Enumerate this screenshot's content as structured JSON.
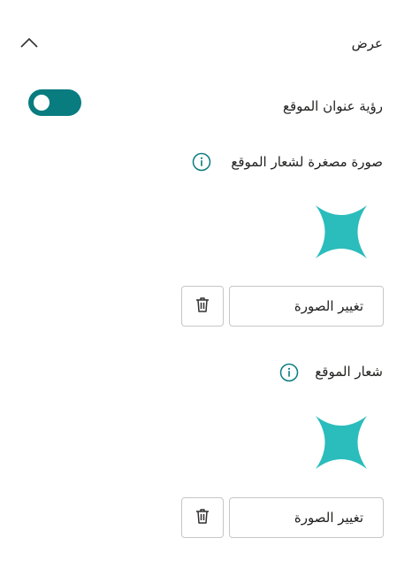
{
  "section": {
    "title": "عرض",
    "collapse_icon": "chevron-up-icon"
  },
  "site_title_visibility": {
    "label": "رؤية عنوان الموقع",
    "enabled": true,
    "accent": "#097c80"
  },
  "site_logo_thumbnail": {
    "label": "صورة مصغرة لشعار الموقع",
    "info_icon": "info-icon",
    "logo_color": "#2bbcbc",
    "change_label": "تغيير الصورة",
    "delete_icon": "trash-icon"
  },
  "site_logo": {
    "label": "شعار الموقع",
    "info_icon": "info-icon",
    "logo_color": "#2bbcbc",
    "change_label": "تغيير الصورة",
    "delete_icon": "trash-icon"
  }
}
